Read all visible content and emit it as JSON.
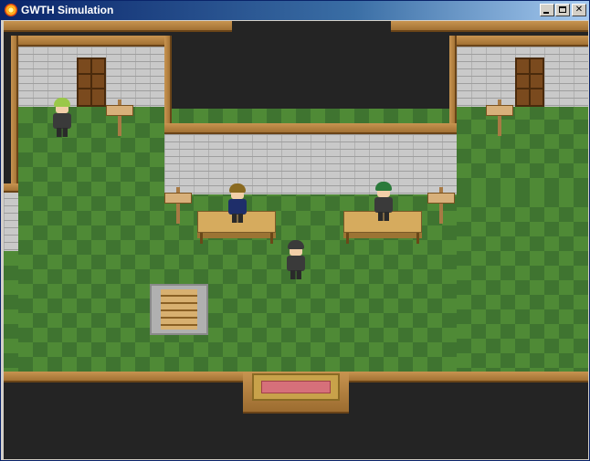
{
  "window": {
    "title": "GWTH Simulation"
  },
  "icons": {
    "app": "app-flame-icon",
    "minimize": "minimize-icon",
    "maximize": "maximize-icon",
    "close": "close-icon"
  },
  "close_glyph": "✕",
  "colors": {
    "titlebar": "#0a246a",
    "floor_light": "#4f8a36",
    "floor_dark": "#3f7430",
    "wood_trim": "#c89450",
    "wall": "#c9c9c9"
  },
  "characters": [
    {
      "name": "npc-green-hair-left",
      "hair": "#9ac84a"
    },
    {
      "name": "npc-blonde-front",
      "hair": "#8a6a20"
    },
    {
      "name": "npc-green-hair-right",
      "hair": "#2a7a3a"
    },
    {
      "name": "npc-dark-hair-center",
      "hair": "#3a3a3a"
    }
  ]
}
